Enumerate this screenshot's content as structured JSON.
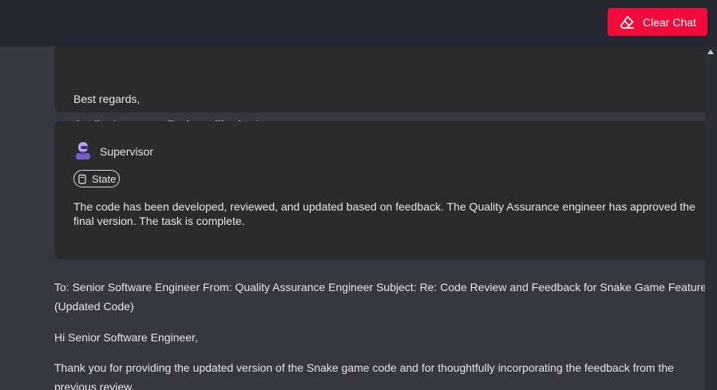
{
  "header": {
    "clear_chat_label": "Clear Chat"
  },
  "messages": {
    "prev_card": {
      "regards": "Best regards,",
      "signature": "Quality Assurance Engineer Flowise Inc."
    },
    "supervisor_card": {
      "agent_name": "Supervisor",
      "state_label": "State",
      "body": "The code has been developed, reviewed, and updated based on feedback. The Quality Assurance engineer has approved the final version. The task is complete."
    },
    "qa_message": {
      "header_line": "To: Senior Software Engineer From: Quality Assurance Engineer Subject: Re: Code Review and Feedback for Snake Game Feature (Updated Code)",
      "greeting": "Hi Senior Software Engineer,",
      "paragraph": "Thank you for providing the updated version of the Snake game code and for thoughtfully incorporating the feedback from the previous review."
    }
  },
  "colors": {
    "clear_button": "#f00b3b",
    "topbar": "#23262e",
    "card": "#2b2b2d",
    "background": "#353841"
  }
}
